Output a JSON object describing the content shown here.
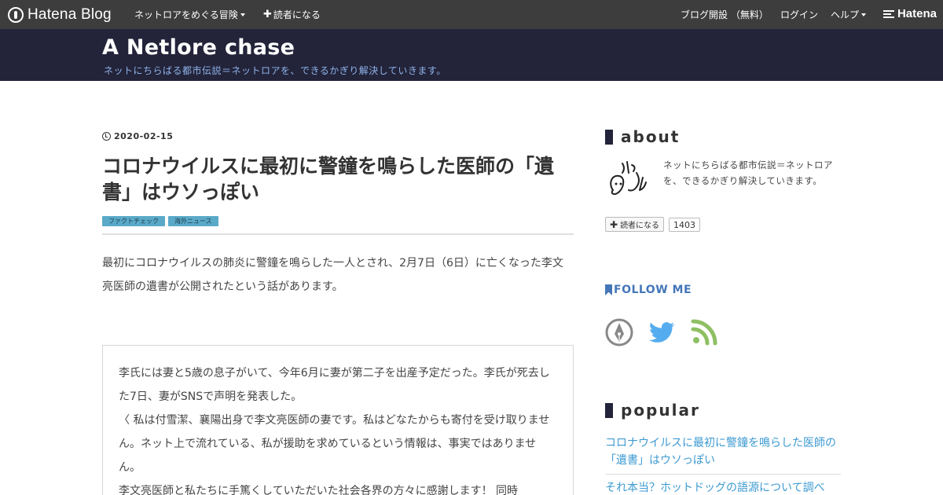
{
  "topbar": {
    "brand": "Hatena Blog",
    "explore": "ネットロアをめぐる冒険",
    "subscribe": "読者になる",
    "open_blog": "ブログ開設 （無料）",
    "login": "ログイン",
    "help": "ヘルプ",
    "hatena": "Hatena"
  },
  "blog": {
    "title": "A Netlore chase",
    "description": "ネットにちらばる都市伝説＝ネットロアを、できるかぎり解決していきます。"
  },
  "post": {
    "date": "2020-02-15",
    "title": "コロナウイルスに最初に警鐘を鳴らした医師の「遺書」はウソっぽい",
    "categories": [
      "ファクトチェック",
      "海外ニュース"
    ],
    "intro": "最初にコロナウイルスの肺炎に警鐘を鳴らした一人とされ、2月7日（6日）に亡くなった李文亮医師の遺書が公開されたという話があります。",
    "quote": [
      "李氏には妻と5歳の息子がいて、今年6月に妻が第二子を出産予定だった。李氏が死去した7日、妻がSNSで声明を発表した。",
      "〈 私は付雪潔、襄陽出身で李文亮医師の妻です。私はどなたからも寄付を受け取りません。ネット上で流れている、私が援助を求めているという情報は、事実ではありません。",
      "李文亮医師と私たちに手篤くしていただいた社会各界の方々に感謝します！ 同時"
    ]
  },
  "sidebar": {
    "about_heading": "about",
    "about_text": "ネットにちらばる都市伝説＝ネットロアを、できるかぎり解決していきます。",
    "reader_button": "読者になる",
    "reader_count": "1403",
    "follow_heading": "FOLLOW ME",
    "social_icons": [
      "hatena-pen-icon",
      "twitter-icon",
      "rss-icon"
    ],
    "popular_heading": "popular",
    "popular": [
      "コロナウイルスに最初に警鐘を鳴らした医師の「遺書」はウソっぽい",
      "それ本当？ホットドッグの語源について調べ"
    ]
  },
  "colors": {
    "topbar": "#3d3d3d",
    "header": "#23243a",
    "tag": "#5aa9c8",
    "link": "#3c9ad2",
    "twitter": "#55acee",
    "rss": "#8ec063"
  }
}
